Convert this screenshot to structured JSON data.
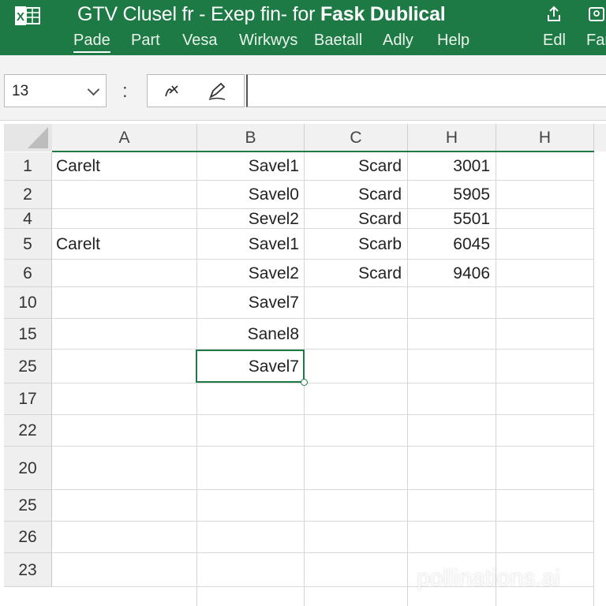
{
  "window": {
    "title_light": "GTV Clusel fr - Exep fin- for ",
    "title_bold": "Fask Dublical",
    "menu": [
      "Pade",
      "Part",
      "Vesa",
      "Wirkwys",
      "Baetall",
      "Adly",
      "Help",
      "Edl",
      "Far"
    ],
    "active_menu_index": 0
  },
  "formula_bar": {
    "name_box": "13",
    "separator": ":",
    "value": ""
  },
  "sheet": {
    "columns": [
      "A",
      "B",
      "C",
      "H",
      "H"
    ],
    "rows": [
      {
        "label": "1",
        "a": "Carelt",
        "b": "Savel1",
        "c": "Scard",
        "h": "3001"
      },
      {
        "label": "2",
        "a": "",
        "b": "Savel0",
        "c": "Scard",
        "h": "5905"
      },
      {
        "label": "4",
        "a": "",
        "b": "Sevel2",
        "c": "Scard",
        "h": "5501"
      },
      {
        "label": "5",
        "a": "Carelt",
        "b": "Savel1",
        "c": "Scarb",
        "h": "6045"
      },
      {
        "label": "6",
        "a": "",
        "b": "Savel2",
        "c": "Scard",
        "h": "9406"
      },
      {
        "label": "10",
        "a": "",
        "b": "Savel7",
        "c": "",
        "h": ""
      },
      {
        "label": "15",
        "a": "",
        "b": "Sanel8",
        "c": "",
        "h": ""
      },
      {
        "label": "25",
        "a": "",
        "b": "Savel7",
        "c": "",
        "h": ""
      },
      {
        "label": "17",
        "a": "",
        "b": "",
        "c": "",
        "h": ""
      },
      {
        "label": "22",
        "a": "",
        "b": "",
        "c": "",
        "h": ""
      },
      {
        "label": "20",
        "a": "",
        "b": "",
        "c": "",
        "h": ""
      },
      {
        "label": "25",
        "a": "",
        "b": "",
        "c": "",
        "h": ""
      },
      {
        "label": "26",
        "a": "",
        "b": "",
        "c": "",
        "h": ""
      },
      {
        "label": "23",
        "a": "",
        "b": "",
        "c": "",
        "h": ""
      }
    ],
    "selected_row_index": 7,
    "selected_column": "B"
  },
  "watermark": "pollinations.ai",
  "colors": {
    "accent": "#1e7a45",
    "grid_line": "#d9d9d9",
    "header_bg": "#f1f1f1"
  }
}
